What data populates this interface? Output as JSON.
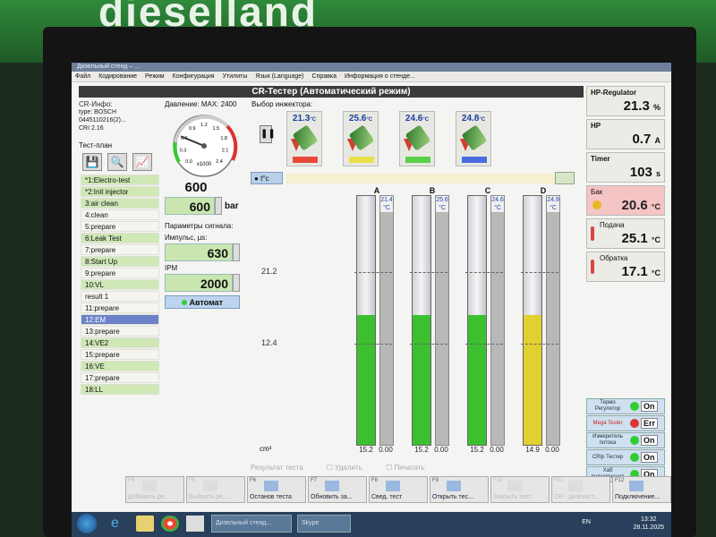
{
  "brand": {
    "logo_text": "dieselland"
  },
  "window": {
    "title": "Дизельный стенд – ..."
  },
  "menu": [
    "Файл",
    "Кодирование",
    "Режим",
    "Конфигурация",
    "Утилиты",
    "Язык (Language)",
    "Справка",
    "Информация о стенде..."
  ],
  "header": {
    "title": "CR-Тестер (Автоматический режим)"
  },
  "info": {
    "label": "CR-Инфо:",
    "type": "type: BOSCH",
    "part": "0445110216(2)...",
    "crii": "CRI 2.16"
  },
  "testplan": {
    "title": "Тест-план",
    "items": [
      {
        "label": "*1:Electro-test",
        "state": "green"
      },
      {
        "label": "*2:Init injector",
        "state": "green"
      },
      {
        "label": "3:air clean",
        "state": "green"
      },
      {
        "label": "4:clean",
        "state": "plain"
      },
      {
        "label": "5:prepare",
        "state": "plain"
      },
      {
        "label": "6:Leak Test",
        "state": "green"
      },
      {
        "label": "7:prepare",
        "state": "plain"
      },
      {
        "label": "8:Start Up",
        "state": "green"
      },
      {
        "label": "9:prepare",
        "state": "plain"
      },
      {
        "label": "10:VL",
        "state": "green"
      },
      {
        "label": "result 1",
        "state": "plain"
      },
      {
        "label": "11:prepare",
        "state": "plain"
      },
      {
        "label": "12:EM",
        "state": "selected"
      },
      {
        "label": "13:prepare",
        "state": "plain"
      },
      {
        "label": "14:VE2",
        "state": "green"
      },
      {
        "label": "15:prepare",
        "state": "plain"
      },
      {
        "label": "16:VE",
        "state": "green"
      },
      {
        "label": "17:prepare",
        "state": "plain"
      },
      {
        "label": "18:LL",
        "state": "green"
      }
    ]
  },
  "pressure": {
    "label": "Давление: MAX: 2400",
    "gauge_unit": "x1000",
    "gauge_ticks": [
      "0.0",
      "0.3",
      "0.6",
      "0.9",
      "1.2",
      "1.5",
      "1.8",
      "2.1",
      "2.4"
    ],
    "gauge_value": 0.6,
    "display": "600",
    "setpoint": "600",
    "unit": "bar"
  },
  "signal": {
    "title": "Параметры сигнала:",
    "pulse_label": "Импульс, µs:",
    "pulse_value": "630",
    "ipm_label": "IPM",
    "ipm_value": "2000",
    "auto_button": "Автомат"
  },
  "injectors": {
    "title": "Выбор инжектора:",
    "items": [
      {
        "temp": "21.3",
        "unit": "°C",
        "color": "#e84a3a"
      },
      {
        "temp": "25.6",
        "unit": "°C",
        "color": "#e8e04a"
      },
      {
        "temp": "24.6",
        "unit": "°C",
        "color": "#5ad04a"
      },
      {
        "temp": "24.8",
        "unit": "°C",
        "color": "#4a6ae0"
      }
    ]
  },
  "tubes": {
    "temp_button": "t°c",
    "unit": "cm³",
    "ticks": [
      "21.2",
      "12.4"
    ],
    "columns": [
      {
        "letter": "A",
        "fill": 0.52,
        "color": "#3cc030",
        "value": "15.2",
        "temp": "21.4",
        "temp_unit": "°C",
        "return_value": "0.00"
      },
      {
        "letter": "B",
        "fill": 0.52,
        "color": "#3cc030",
        "value": "15.2",
        "temp": "25.6",
        "temp_unit": "°C",
        "return_value": "0.00"
      },
      {
        "letter": "C",
        "fill": 0.52,
        "color": "#3cc030",
        "value": "15.2",
        "temp": "24.6",
        "temp_unit": "°C",
        "return_value": "0.00"
      },
      {
        "letter": "D",
        "fill": 0.52,
        "color": "#e0d030",
        "value": "14.9",
        "temp": "24.9",
        "temp_unit": "°C",
        "return_value": "0.00"
      }
    ],
    "results_label": "Результат теста",
    "delete_label": "Удалить",
    "print_label": "Печатать"
  },
  "right": {
    "hp_regulator": {
      "label": "HP-Regulator",
      "value": "21.3",
      "unit": "%"
    },
    "hp": {
      "label": "HP",
      "value": "0.7",
      "unit": "A"
    },
    "timer": {
      "label": "Timer",
      "value": "103",
      "unit": "s"
    },
    "tank": {
      "label": "Бак",
      "value": "20.6",
      "unit": "°C"
    },
    "supply": {
      "label": "Подача",
      "value": "25.1",
      "unit": "°C"
    },
    "return": {
      "label": "Обратка",
      "value": "17.1",
      "unit": "°C"
    },
    "toggles": [
      {
        "label": "Термо Регулятор",
        "value": "On",
        "state": "on"
      },
      {
        "label": "Mega Tester",
        "value": "Err",
        "state": "err"
      },
      {
        "label": "Измеритель потока",
        "value": "On",
        "state": "on"
      },
      {
        "label": "CRIp Тестер",
        "value": "On",
        "state": "on"
      },
      {
        "label": "Хаб подключения",
        "value": "On",
        "state": "on"
      }
    ]
  },
  "fkeys": [
    {
      "key": "F5",
      "label": "Добавить ре...",
      "dim": true
    },
    {
      "key": "F6",
      "label": "Выбрать ре...",
      "dim": true
    },
    {
      "key": "F6",
      "label": "Останов теста",
      "dim": false
    },
    {
      "key": "F7",
      "label": "Обновить за...",
      "dim": false
    },
    {
      "key": "F8",
      "label": "Свед. тест",
      "dim": false
    },
    {
      "key": "F9",
      "label": "Открыть тес...",
      "dim": false
    },
    {
      "key": "F10",
      "label": "Закрыть тест",
      "dim": true
    },
    {
      "key": "F11",
      "label": "CR - диагност...",
      "dim": true
    },
    {
      "key": "F12",
      "label": "Подключение...",
      "dim": false
    }
  ],
  "taskbar": {
    "app_label": "Дизельный стенд...",
    "skype_label": "Skype",
    "lang": "EN",
    "time": "13:32",
    "date": "28.11.2025"
  }
}
